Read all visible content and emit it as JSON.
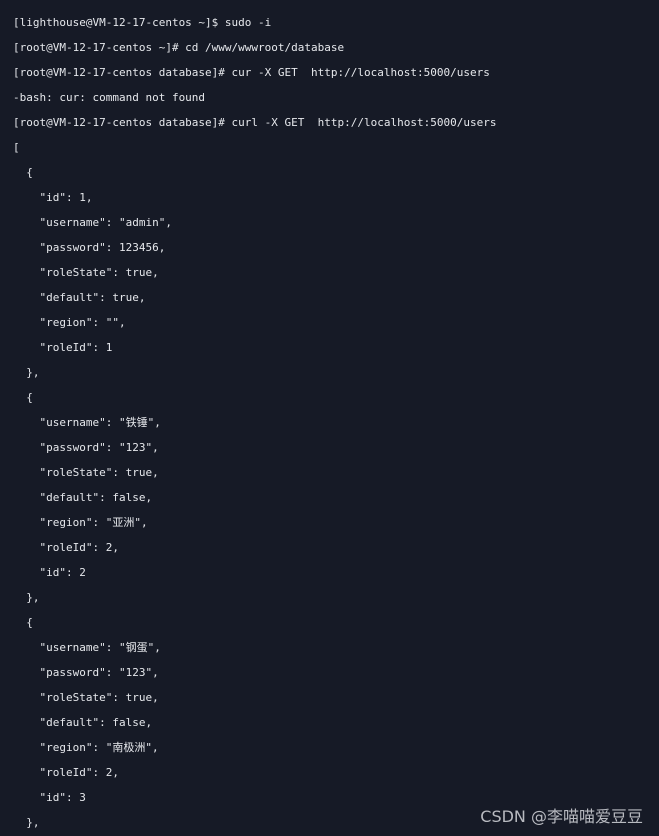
{
  "terminal": {
    "lines": [
      "[lighthouse@VM-12-17-centos ~]$ sudo -i",
      "[root@VM-12-17-centos ~]# cd /www/wwwroot/database",
      "[root@VM-12-17-centos database]# cur -X GET  http://localhost:5000/users",
      "-bash: cur: command not found",
      "[root@VM-12-17-centos database]# curl -X GET  http://localhost:5000/users",
      "[",
      "  {",
      "    \"id\": 1,",
      "    \"username\": \"admin\",",
      "    \"password\": 123456,",
      "    \"roleState\": true,",
      "    \"default\": true,",
      "    \"region\": \"\",",
      "    \"roleId\": 1",
      "  },",
      "  {",
      "    \"username\": \"铁锤\",",
      "    \"password\": \"123\",",
      "    \"roleState\": true,",
      "    \"default\": false,",
      "    \"region\": \"亚洲\",",
      "    \"roleId\": 2,",
      "    \"id\": 2",
      "  },",
      "  {",
      "    \"username\": \"钢蛋\",",
      "    \"password\": \"123\",",
      "    \"roleState\": true,",
      "    \"default\": false,",
      "    \"region\": \"南极洲\",",
      "    \"roleId\": 2,",
      "    \"id\": 3",
      "  },"
    ]
  },
  "watermark": "CSDN @李喵喵爱豆豆"
}
